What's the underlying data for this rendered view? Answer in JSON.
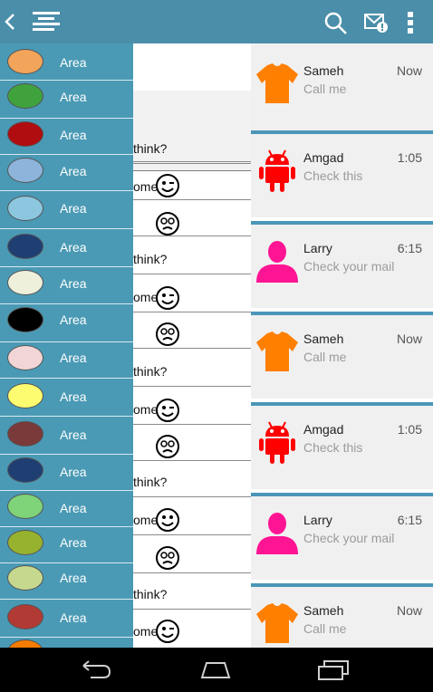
{
  "drawer": {
    "items": [
      {
        "label": "Area",
        "color": "#f2a45a"
      },
      {
        "label": "Area",
        "color": "#3fa23d"
      },
      {
        "label": "Area",
        "color": "#b00d10"
      },
      {
        "label": "Area",
        "color": "#8db4da"
      },
      {
        "label": "Area",
        "color": "#8dc7df"
      },
      {
        "label": "Area",
        "color": "#1f3f73"
      },
      {
        "label": "Area",
        "color": "#eef0dc"
      },
      {
        "label": "Area",
        "color": "#000000"
      },
      {
        "label": "Area",
        "color": "#f2d5d6"
      },
      {
        "label": "Area",
        "color": "#fdfb70"
      },
      {
        "label": "Area",
        "color": "#7a3a3a"
      },
      {
        "label": "Area",
        "color": "#1f3f73"
      },
      {
        "label": "Area",
        "color": "#7fd379"
      },
      {
        "label": "Area",
        "color": "#97b22e"
      },
      {
        "label": "Area",
        "color": "#c6d88e"
      },
      {
        "label": "Area",
        "color": "#b23a35"
      },
      {
        "label": "",
        "color": "#f57c00"
      }
    ]
  },
  "chat": {
    "lines": [
      "think?",
      "ome",
      "think?",
      "ome",
      "think?",
      "ome",
      "think?",
      "ome",
      "think?",
      "ome"
    ]
  },
  "messages": [
    {
      "name": "Sameh",
      "time": "Now",
      "preview": "Call me",
      "avatar": "tshirt-icon",
      "color": "#ff7f00"
    },
    {
      "name": "Amgad",
      "time": "1:05",
      "preview": "Check this",
      "avatar": "android-icon",
      "color": "#ff0000"
    },
    {
      "name": "Larry",
      "time": "6:15",
      "preview": "Check your mail",
      "avatar": "person-icon",
      "color": "#ff1493"
    },
    {
      "name": "Sameh",
      "time": "Now",
      "preview": "Call me",
      "avatar": "tshirt-icon",
      "color": "#ff7f00"
    },
    {
      "name": "Amgad",
      "time": "1:05",
      "preview": "Check this",
      "avatar": "android-icon",
      "color": "#ff0000"
    },
    {
      "name": "Larry",
      "time": "6:15",
      "preview": "Check your mail",
      "avatar": "person-icon",
      "color": "#ff1493"
    },
    {
      "name": "Sameh",
      "time": "Now",
      "preview": "Call me",
      "avatar": "tshirt-icon",
      "color": "#ff7f00"
    }
  ],
  "icons": {
    "back": "back-chevron-icon",
    "menu": "menu-icon",
    "search": "search-icon",
    "mail": "mail-notification-icon",
    "overflow": "overflow-menu-icon"
  }
}
